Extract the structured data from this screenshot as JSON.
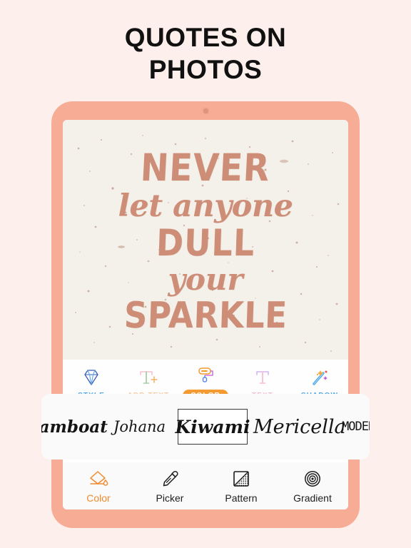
{
  "page": {
    "background_color": "#FDF0EC",
    "headline_line1": "QUOTES ON",
    "headline_line2": "PHOTOS"
  },
  "device": {
    "frame_color": "#F7AC95",
    "camera_icon": "camera-dot-icon"
  },
  "artwork": {
    "background_color": "#F4F0EA",
    "text_color": "#CE8D77",
    "lines": [
      {
        "text": "NEVER"
      },
      {
        "text": "let anyone"
      },
      {
        "text": "DULL"
      },
      {
        "text": "your"
      },
      {
        "text": "SPARKLE"
      }
    ]
  },
  "editor_toolbar": {
    "items": [
      {
        "label": "STYLE",
        "icon": "diamond-icon",
        "state": "enabled",
        "color": "#4FA6E8"
      },
      {
        "label": "ADD TEXT",
        "icon": "add-text-icon",
        "state": "disabled",
        "color": "#F6CBA2"
      },
      {
        "label": "COLOR",
        "icon": "paint-roller-icon",
        "state": "selected",
        "color": "#F59A31"
      },
      {
        "label": "TEXT",
        "icon": "text-t-icon",
        "state": "disabled",
        "color": "#F7BECB"
      },
      {
        "label": "SHADOW",
        "icon": "magic-wand-icon",
        "state": "enabled",
        "color": "#4FA6E8"
      }
    ]
  },
  "font_carousel": {
    "items": [
      {
        "label": "eamboat",
        "selected": false
      },
      {
        "label": "Johana",
        "selected": false
      },
      {
        "label": "Kiwami",
        "selected": true
      },
      {
        "label": "Mericella",
        "selected": false
      },
      {
        "label": "MODERNMAGI",
        "selected": false
      }
    ]
  },
  "color_toolbar": {
    "items": [
      {
        "label": "Color",
        "icon": "paint-bucket-icon",
        "active": true,
        "color": "#F08A2E"
      },
      {
        "label": "Picker",
        "icon": "eyedropper-icon",
        "active": false,
        "color": "#1D1D1D"
      },
      {
        "label": "Pattern",
        "icon": "pattern-square-icon",
        "active": false,
        "color": "#1D1D1D"
      },
      {
        "label": "Gradient",
        "icon": "gradient-circles-icon",
        "active": false,
        "color": "#1D1D1D"
      }
    ]
  }
}
